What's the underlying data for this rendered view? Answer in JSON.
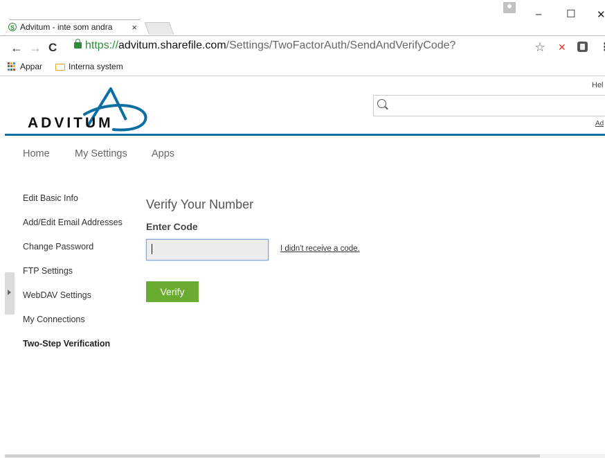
{
  "browser": {
    "tab": {
      "title": "Advitum - inte som andra",
      "favicon": "sharefile-icon",
      "close": "×"
    },
    "window_controls": {
      "minimize": "–",
      "maximize": "☐",
      "close": "✕"
    },
    "nav": {
      "back": "←",
      "forward": "→",
      "reload": "C"
    },
    "address": {
      "scheme": "https://",
      "host": "advitum.sharefile.com",
      "path": "/Settings/TwoFactorAuth/SendAndVerifyCode?"
    },
    "toolbar_icons": {
      "star": "☆",
      "extension_1": "✕",
      "menu": "⋮"
    },
    "bookmarks": [
      {
        "label": "Appar",
        "icon": "apps-grid-icon"
      },
      {
        "label": "Interna system",
        "icon": "folder-icon"
      }
    ]
  },
  "header": {
    "logo_text": "ADVITUM",
    "help_text": "Hel",
    "search_placeholder": "",
    "right_link": "Ad",
    "accent_color": "#0b6fa4"
  },
  "main_nav": [
    "Home",
    "My Settings",
    "Apps"
  ],
  "sidebar": {
    "items": [
      {
        "label": "Edit Basic Info",
        "active": false
      },
      {
        "label": "Add/Edit Email Addresses",
        "active": false
      },
      {
        "label": "Change Password",
        "active": false
      },
      {
        "label": "FTP Settings",
        "active": false
      },
      {
        "label": "WebDAV Settings",
        "active": false
      },
      {
        "label": "My Connections",
        "active": false
      },
      {
        "label": "Two-Step Verification",
        "active": true
      }
    ]
  },
  "content": {
    "heading": "Verify Your Number",
    "code_label": "Enter Code",
    "code_value": "",
    "no_code_link": "I didn't receive a code.",
    "verify_button": "Verify",
    "button_color": "#6aab32"
  }
}
